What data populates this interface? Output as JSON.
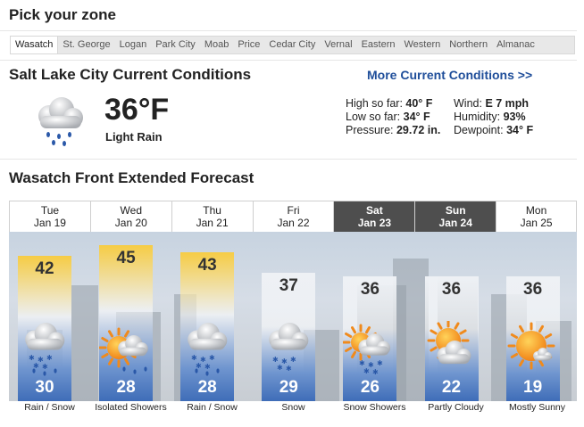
{
  "pick_zone": {
    "title": "Pick your zone"
  },
  "zones": [
    "Wasatch",
    "St. George",
    "Logan",
    "Park City",
    "Moab",
    "Price",
    "Cedar City",
    "Vernal",
    "Eastern",
    "Western",
    "Northern",
    "Almanac"
  ],
  "selected_zone": "Wasatch",
  "current": {
    "title": "Salt Lake City Current Conditions",
    "more_link": "More Current Conditions >>",
    "temp": "36°F",
    "condition": "Light Rain",
    "icon": "rain-cloud-icon",
    "high": {
      "label": "High so far:",
      "value": "40° F"
    },
    "low": {
      "label": "Low so far:",
      "value": "34° F"
    },
    "pressure": {
      "label": "Pressure:",
      "value": "29.72 in."
    },
    "wind": {
      "label": "Wind:",
      "value": "E 7 mph"
    },
    "humidity": {
      "label": "Humidity:",
      "value": "93%"
    },
    "dewpoint": {
      "label": "Dewpoint:",
      "value": "34° F"
    }
  },
  "forecast": {
    "title": "Wasatch Front Extended Forecast",
    "days": [
      {
        "dow": "Tue",
        "date": "Jan 19",
        "hi": "42",
        "lo": "30",
        "cond": "Rain / Snow",
        "icon": "rain-snow-icon",
        "weekend": false
      },
      {
        "dow": "Wed",
        "date": "Jan 20",
        "hi": "45",
        "lo": "28",
        "cond": "Isolated Showers",
        "icon": "sun-showers-icon",
        "weekend": false
      },
      {
        "dow": "Thu",
        "date": "Jan 21",
        "hi": "43",
        "lo": "28",
        "cond": "Rain / Snow",
        "icon": "rain-snow-icon",
        "weekend": false
      },
      {
        "dow": "Fri",
        "date": "Jan 22",
        "hi": "37",
        "lo": "29",
        "cond": "Snow",
        "icon": "snow-icon",
        "weekend": false
      },
      {
        "dow": "Sat",
        "date": "Jan 23",
        "hi": "36",
        "lo": "26",
        "cond": "Snow Showers",
        "icon": "sun-snow-showers-icon",
        "weekend": true
      },
      {
        "dow": "Sun",
        "date": "Jan 24",
        "hi": "36",
        "lo": "22",
        "cond": "Partly Cloudy",
        "icon": "partly-cloudy-icon",
        "weekend": true
      },
      {
        "dow": "Mon",
        "date": "Jan 25",
        "hi": "36",
        "lo": "19",
        "cond": "Mostly Sunny",
        "icon": "mostly-sunny-icon",
        "weekend": false
      }
    ]
  },
  "colors": {
    "link": "#1f4e9a",
    "weekend_header": "#4e4e4e",
    "warm_bar": "#f3c94a",
    "cool_bar": "#3f6db8"
  }
}
